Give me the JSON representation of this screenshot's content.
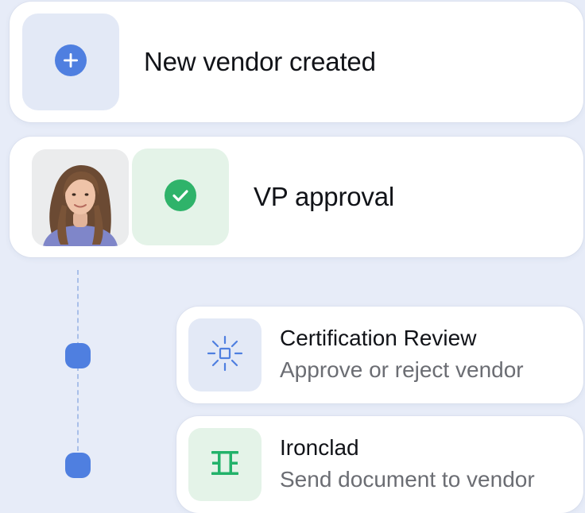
{
  "steps": [
    {
      "title": "New vendor created",
      "icon": "plus-circle-icon"
    },
    {
      "title": "VP approval",
      "icon": "check-circle-icon",
      "avatar": "person-avatar"
    },
    {
      "title": "Certification Review",
      "subtitle": "Approve or reject vendor",
      "icon": "sparkle-crosshair-icon"
    },
    {
      "title": "Ironclad",
      "subtitle": "Send document to vendor",
      "icon": "ironclad-logo-icon"
    }
  ],
  "colors": {
    "background": "#e7ecf8",
    "card": "#ffffff",
    "blue_tile": "#e3e9f6",
    "green_tile": "#e4f3e8",
    "accent_blue": "#4f7fe0",
    "accent_green": "#2fb36a",
    "connector": "#a9bfe9"
  }
}
